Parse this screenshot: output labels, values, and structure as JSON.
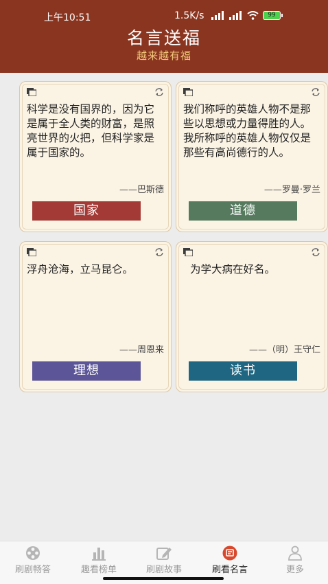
{
  "status_bar": {
    "time": "上午10:51",
    "network_speed": "1.5K/s",
    "battery": "99"
  },
  "header": {
    "title": "名言送福",
    "subtitle": "越来越有福"
  },
  "cards": [
    {
      "text": "科学是没有国界的，因为它是属于全人类的财富，是照亮世界的火把，但科学家是属于国家的。",
      "author": "——巴斯德",
      "tag": "国家",
      "tag_color": "#a33a36"
    },
    {
      "text": "我们称呼的英雄人物不是那些以思想或力量得胜的人。我所称呼的英雄人物仅仅是那些有高尚德行的人。",
      "author": "——罗曼·罗兰",
      "tag": "道德",
      "tag_color": "#557a5e"
    },
    {
      "text": "浮舟沧海，立马昆仑。",
      "author": "——周恩来",
      "tag": "理想",
      "tag_color": "#5c5698"
    },
    {
      "text": "为学大病在好名。",
      "author": "——（明）王守仁",
      "tag": "读书",
      "tag_color": "#1e6681"
    }
  ],
  "tabs": [
    {
      "label": "刷剧畅答",
      "icon": "film-reel-icon"
    },
    {
      "label": "趣看榜单",
      "icon": "bar-chart-icon"
    },
    {
      "label": "刷剧故事",
      "icon": "pen-icon"
    },
    {
      "label": "刷看名言",
      "icon": "quote-icon",
      "active": true
    },
    {
      "label": "更多",
      "icon": "user-icon"
    }
  ]
}
